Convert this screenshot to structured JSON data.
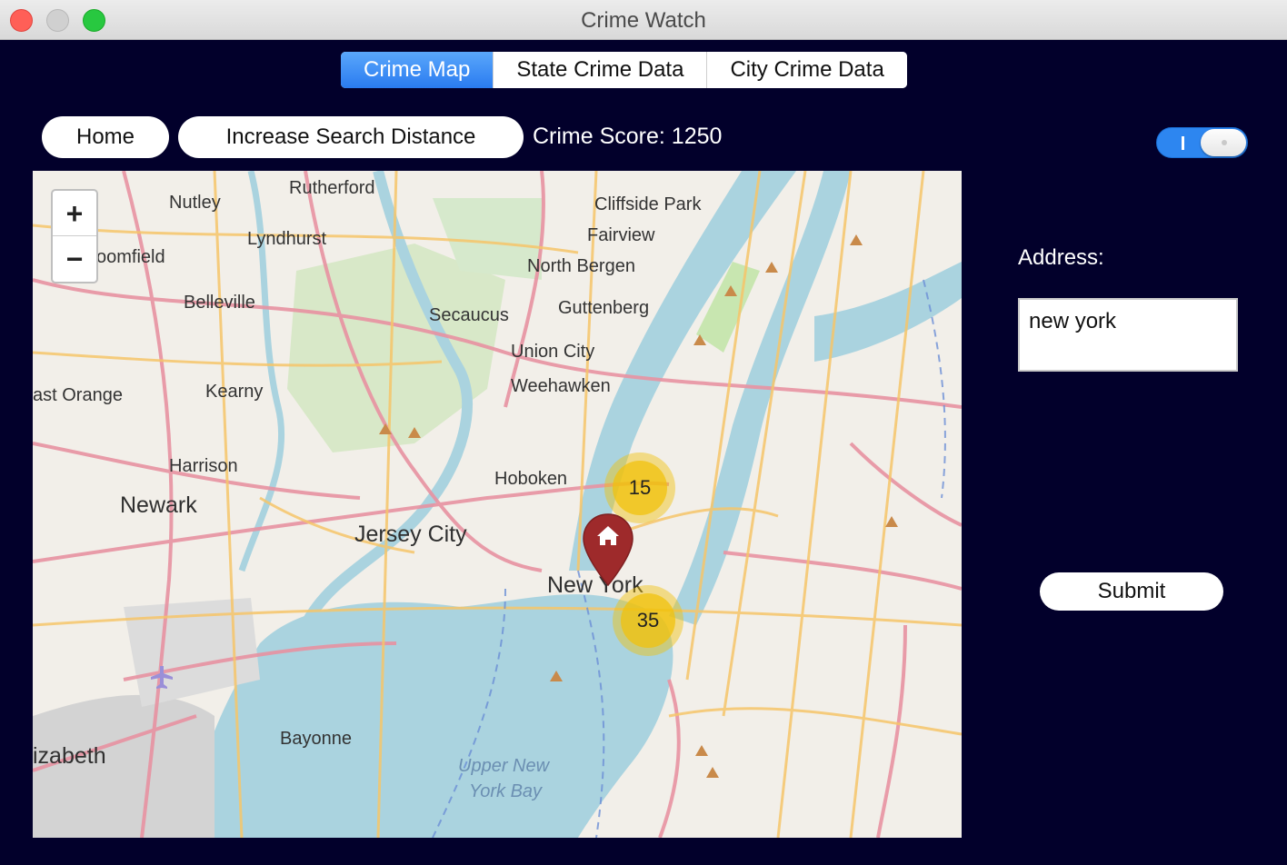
{
  "window": {
    "title": "Crime Watch"
  },
  "tabs": [
    {
      "label": "Crime Map",
      "active": true
    },
    {
      "label": "State Crime Data",
      "active": false
    },
    {
      "label": "City Crime Data",
      "active": false
    }
  ],
  "toolbar": {
    "home_label": "Home",
    "increase_label": "Increase Search Distance",
    "crime_score": "Crime Score: 1250"
  },
  "toggle": {
    "state": "on"
  },
  "map": {
    "zoom_in": "+",
    "zoom_out": "−",
    "places": [
      "Rutherford",
      "Nutley",
      "Lyndhurst",
      "oomfield",
      "Belleville",
      "Cliffside Park",
      "Fairview",
      "North Bergen",
      "Guttenberg",
      "Secaucus",
      "Union City",
      "Weehawken",
      "Kearny",
      "ast Orange",
      "Harrison",
      "Newark",
      "Hoboken",
      "Jersey City",
      "New York",
      "Bayonne",
      "izabeth"
    ],
    "water_labels": [
      "Upper New",
      "York Bay"
    ],
    "clusters": [
      {
        "count": "15"
      },
      {
        "count": "35"
      }
    ],
    "marker": "home-marker"
  },
  "form": {
    "address_label": "Address:",
    "address_value": "new york",
    "submit_label": "Submit"
  },
  "colors": {
    "background": "#02002b",
    "accent": "#2a7bf0",
    "cluster": "#f0c20c",
    "marker": "#9e2a2b"
  }
}
